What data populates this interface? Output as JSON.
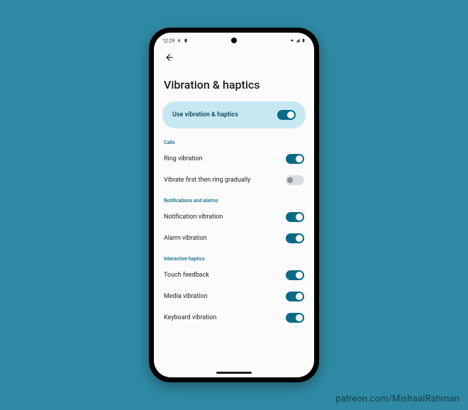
{
  "status": {
    "time": "12:29",
    "icons": [
      "universal-icon",
      "battery-icon",
      "wifi-icon",
      "signal-icon",
      "battery-icon"
    ]
  },
  "page": {
    "title": "Vibration & haptics"
  },
  "hero": {
    "label": "Use vibration & haptics",
    "on": true
  },
  "sections": [
    {
      "header": "Calls",
      "rows": [
        {
          "key": "ring-vibration",
          "label": "Ring vibration",
          "on": true
        },
        {
          "key": "vibrate-first-then-ring",
          "label": "Vibrate first then ring gradually",
          "on": false
        }
      ]
    },
    {
      "header": "Notifications and alarms",
      "rows": [
        {
          "key": "notification-vibration",
          "label": "Notification vibration",
          "on": true
        },
        {
          "key": "alarm-vibration",
          "label": "Alarm vibration",
          "on": true
        }
      ]
    },
    {
      "header": "Interactive haptics",
      "rows": [
        {
          "key": "touch-feedback",
          "label": "Touch feedback",
          "on": true
        },
        {
          "key": "media-vibration",
          "label": "Media vibration",
          "on": true
        },
        {
          "key": "keyboard-vibration",
          "label": "Keyboard vibration",
          "on": true
        }
      ]
    }
  ],
  "watermark": "patreon.com/MishaalRahman"
}
